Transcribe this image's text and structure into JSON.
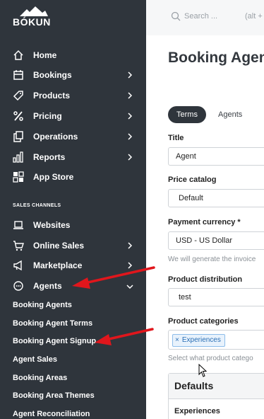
{
  "brand": {
    "name": "BÓKUN"
  },
  "sidebar": {
    "main_items": [
      {
        "label": "Home",
        "icon": "home-icon"
      },
      {
        "label": "Bookings",
        "icon": "calendar-icon"
      },
      {
        "label": "Products",
        "icon": "tag-icon"
      },
      {
        "label": "Pricing",
        "icon": "percent-icon"
      },
      {
        "label": "Operations",
        "icon": "copy-icon"
      },
      {
        "label": "Reports",
        "icon": "bar-chart-icon"
      },
      {
        "label": "App Store",
        "icon": "app-grid-icon"
      }
    ],
    "section_title": "SALES CHANNELS",
    "channel_items": [
      {
        "label": "Websites",
        "icon": "laptop-icon"
      },
      {
        "label": "Online Sales",
        "icon": "cart-icon"
      },
      {
        "label": "Marketplace",
        "icon": "megaphone-icon"
      },
      {
        "label": "Agents",
        "icon": "chat-icon"
      }
    ],
    "agent_subitems": [
      "Booking Agents",
      "Booking Agent Terms",
      "Booking Agent Signup",
      "Agent Sales",
      "Booking Areas",
      "Booking Area Themes",
      "Agent Reconciliation"
    ]
  },
  "topbar": {
    "search_placeholder": "Search ...",
    "search_shortcut": "(alt +"
  },
  "main": {
    "page_title": "Booking Agent",
    "tabs": [
      "Terms",
      "Agents"
    ],
    "active_tab": "Terms",
    "form": {
      "title_label": "Title",
      "title_value": "Agent",
      "price_catalog_label": "Price catalog",
      "price_catalog_value": "Default",
      "currency_label": "Payment currency *",
      "currency_value": "USD - US Dollar",
      "currency_help": "We will generate the invoice",
      "distribution_label": "Product distribution",
      "distribution_value": "test",
      "categories_label": "Product categories",
      "categories_tag_remove": "×",
      "categories_tag": "Experiences",
      "categories_help": "Select what product catego"
    },
    "panel": {
      "title": "Defaults",
      "subtitle": "Experiences"
    }
  },
  "colors": {
    "sidebar_bg": "#2f353c",
    "arrow": "#e0161c",
    "tag_border": "#8dbcea"
  }
}
